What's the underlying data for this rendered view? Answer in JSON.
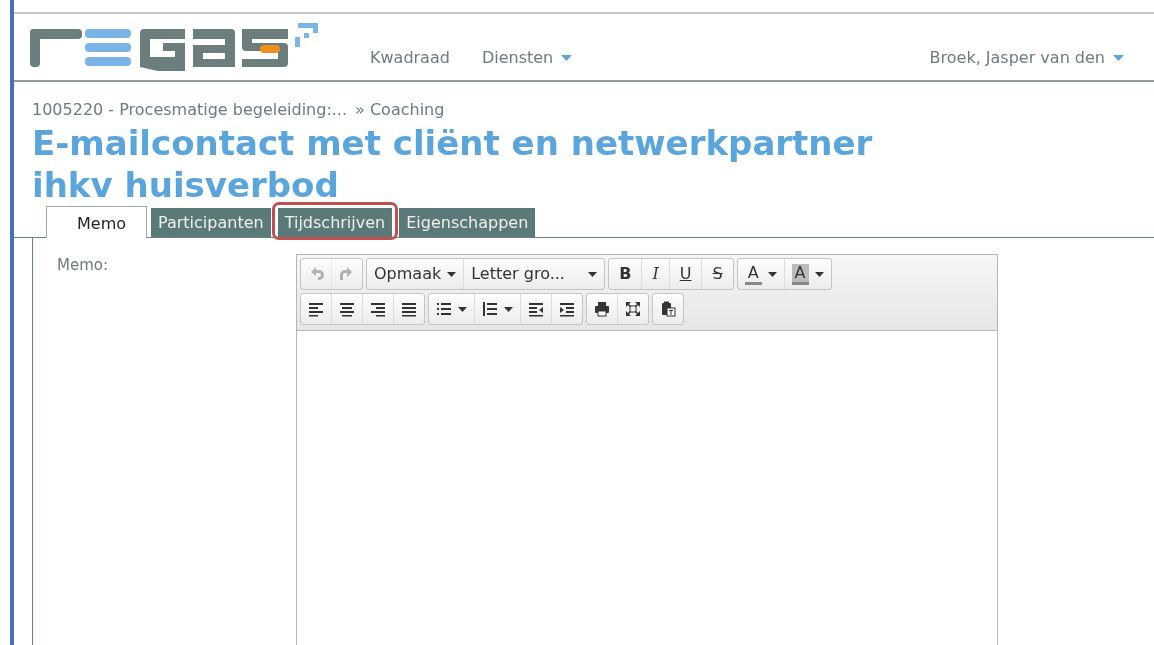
{
  "nav": {
    "items": [
      {
        "label": "Kwadraad",
        "dropdown": false
      },
      {
        "label": "Diensten",
        "dropdown": true
      }
    ],
    "user": {
      "label": "Broek, Jasper van den",
      "dropdown": true
    }
  },
  "breadcrumb": [
    {
      "label": "1005220 - Procesmatige begeleiding:..."
    },
    {
      "label": "» Coaching"
    }
  ],
  "title": "E-mailcontact met cliënt en netwerkpartner ihkv huisverbod",
  "tabs": [
    {
      "label": "Memo",
      "selected": true,
      "highlighted": false
    },
    {
      "label": "Participanten",
      "selected": false,
      "highlighted": false
    },
    {
      "label": "Tijdschrijven",
      "selected": false,
      "highlighted": true
    },
    {
      "label": "Eigenschappen",
      "selected": false,
      "highlighted": false
    }
  ],
  "memo_label": "Memo:",
  "toolbar": [
    [
      [
        {
          "kind": "icon",
          "disabled": true
        },
        {
          "kind": "icon",
          "disabled": true
        }
      ],
      [
        {
          "kind": "menu",
          "label": "Opmaak"
        },
        {
          "kind": "menu",
          "label": "Letter gro..."
        }
      ],
      [
        {
          "kind": "letter",
          "label": "B"
        },
        {
          "kind": "letter",
          "label": "I"
        },
        {
          "kind": "letter",
          "label": "U"
        },
        {
          "kind": "letter",
          "label": "S"
        }
      ],
      [
        {
          "kind": "color",
          "label": "A"
        },
        {
          "kind": "color",
          "label": "A"
        }
      ]
    ],
    [
      [
        {
          "kind": "icon",
          "disabled": false
        },
        {
          "kind": "icon",
          "disabled": false
        },
        {
          "kind": "icon",
          "disabled": false
        },
        {
          "kind": "icon",
          "disabled": false
        }
      ],
      [
        {
          "kind": "split",
          "disabled": false
        },
        {
          "kind": "split",
          "disabled": false
        },
        {
          "kind": "icon",
          "disabled": false
        },
        {
          "kind": "icon",
          "disabled": false
        }
      ],
      [
        {
          "kind": "icon",
          "disabled": false
        },
        {
          "kind": "icon",
          "disabled": false
        }
      ],
      [
        {
          "kind": "icon",
          "disabled": false
        }
      ]
    ]
  ]
}
